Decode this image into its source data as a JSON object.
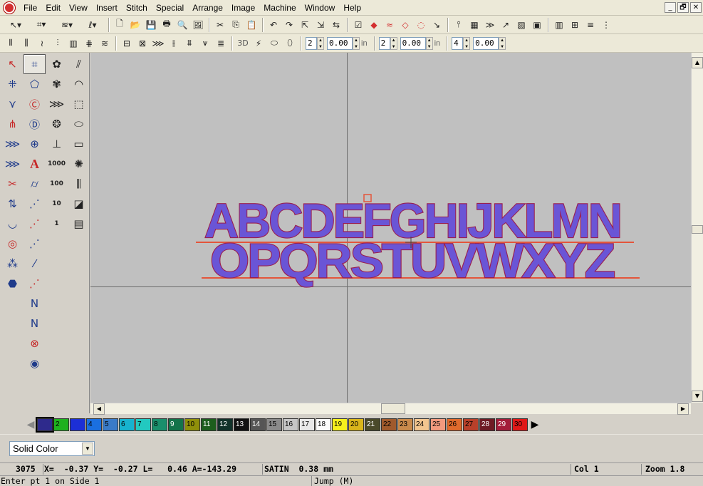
{
  "menu": [
    "File",
    "Edit",
    "View",
    "Insert",
    "Stitch",
    "Special",
    "Arrange",
    "Image",
    "Machine",
    "Window",
    "Help"
  ],
  "window_buttons": [
    "_",
    "🗗",
    "✕"
  ],
  "toolbar1_icons": [
    "↖▾",
    "⌗▾",
    "≋▾",
    "ℓ▾",
    "🗋",
    "📂",
    "💾",
    "🖶",
    "🔍",
    "🖼",
    "✂",
    "⎘",
    "📋",
    "↶",
    "↷",
    "⇱",
    "⇲",
    "⇆",
    "☑",
    "◆",
    "≈",
    "◇",
    "◌",
    "↘",
    "⫯",
    "▦",
    "≫",
    "↗",
    "▧",
    "▣",
    "▥",
    "⊞",
    "≡",
    "⋮"
  ],
  "toolbar2_icons": [
    "⫴",
    "⫼",
    "≀",
    "⫶",
    "▥",
    "⋕",
    "≋",
    "⊟",
    "⊠",
    "⋙",
    "⫲",
    "⩩",
    "⩛",
    "≣",
    "3D",
    "⚡",
    "⬭",
    "⬯"
  ],
  "toolbar2_fields": [
    {
      "value": "2",
      "unit": ""
    },
    {
      "value": "0.00",
      "unit": "in"
    },
    {
      "value": "2",
      "unit": ""
    },
    {
      "value": "0.00",
      "unit": "in"
    },
    {
      "value": "4",
      "unit": ""
    },
    {
      "value": "0.00",
      "unit": ""
    }
  ],
  "palette_icons": [
    "↖",
    "⌗",
    "✿",
    "⫽",
    "⁜",
    "⬠",
    "✾",
    "◠",
    "⋎",
    "Ⓒ",
    "⋙",
    "⬚",
    "⋔",
    "Ⓓ",
    "❂",
    "⬭",
    "⋙",
    "⊕",
    "⊥",
    "▭",
    "⋙",
    "A",
    "1000",
    "✺",
    "✂",
    "⌭",
    "100",
    "⫼",
    "⇅",
    "⋰",
    "10",
    "◪",
    "◡",
    "⋰",
    "1",
    "▤",
    "◎",
    "⋰",
    "",
    "",
    "⁂",
    "⁄",
    "",
    "",
    "⬣",
    "⋰",
    "",
    "",
    "",
    "N",
    "",
    "",
    "",
    "N",
    "",
    "",
    "",
    "⊗",
    "",
    "",
    "",
    "◉",
    "",
    ""
  ],
  "design": {
    "line1": "ABCDEFGHIJKLMN",
    "line2": "OPQRSTUVWXYZ"
  },
  "colors": [
    {
      "num": "",
      "hex": "#2e2a8c"
    },
    {
      "num": "2",
      "hex": "#1fb11f"
    },
    {
      "num": "",
      "hex": "#1c2fd6"
    },
    {
      "num": "4",
      "hex": "#1a6fe0"
    },
    {
      "num": "5",
      "hex": "#3a7bc8"
    },
    {
      "num": "6",
      "hex": "#17b3cf"
    },
    {
      "num": "7",
      "hex": "#22c9c0"
    },
    {
      "num": "8",
      "hex": "#1a8f6c"
    },
    {
      "num": "9",
      "hex": "#13734a"
    },
    {
      "num": "10",
      "hex": "#8f8f0a"
    },
    {
      "num": "11",
      "hex": "#1d5e1d"
    },
    {
      "num": "12",
      "hex": "#12322a"
    },
    {
      "num": "13",
      "hex": "#111111"
    },
    {
      "num": "14",
      "hex": "#555555"
    },
    {
      "num": "15",
      "hex": "#8a8a8a"
    },
    {
      "num": "16",
      "hex": "#c6c6c6"
    },
    {
      "num": "17",
      "hex": "#e8e8e8"
    },
    {
      "num": "18",
      "hex": "#fbfbfb"
    },
    {
      "num": "19",
      "hex": "#f6f01c"
    },
    {
      "num": "20",
      "hex": "#d9b51b"
    },
    {
      "num": "21",
      "hex": "#4a4a2a"
    },
    {
      "num": "22",
      "hex": "#a05a2c"
    },
    {
      "num": "23",
      "hex": "#c98a4b"
    },
    {
      "num": "24",
      "hex": "#f2c58f"
    },
    {
      "num": "25",
      "hex": "#f29a7e"
    },
    {
      "num": "26",
      "hex": "#e06a2c"
    },
    {
      "num": "27",
      "hex": "#b8402a"
    },
    {
      "num": "28",
      "hex": "#6e1b24"
    },
    {
      "num": "29",
      "hex": "#a41c3a"
    },
    {
      "num": "30",
      "hex": "#e01818"
    }
  ],
  "fill": {
    "selected": "Solid Color"
  },
  "status": {
    "stitch": "3075",
    "coords": "X=  -0.37 Y=  -0.27 L=   0.46 A=-143.29",
    "type": "SATIN  0.38 mm",
    "col": "Col 1",
    "zoom": "Zoom 1.8",
    "prompt": "Enter pt 1 on Side 1",
    "mode": "Jump (M)"
  }
}
